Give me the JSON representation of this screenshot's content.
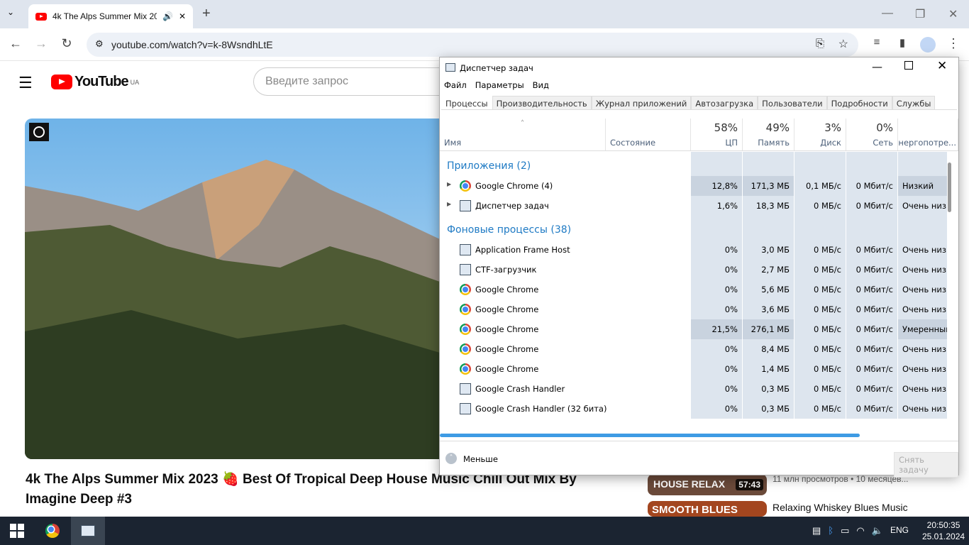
{
  "browser": {
    "tab_title": "4k The Alps Summer Mix 20",
    "url": "youtube.com/watch?v=k-8WsndhLtE"
  },
  "youtube": {
    "logo": "YouTube",
    "region": "UA",
    "search_placeholder": "Введите запрос",
    "video_title": "4k The Alps Summer Mix 2023 🍓 Best Of Tropical Deep House Music Chill Out Mix By Imagine Deep #3",
    "related": [
      {
        "thumb_text": "HOUSE RELAX",
        "duration": "57:43",
        "meta": "11 млн просмотров • 10 месяцев..."
      },
      {
        "thumb_text": "SMOOTH BLUES",
        "title": "Relaxing Whiskey Blues Music"
      }
    ]
  },
  "task_manager": {
    "title": "Диспетчер задач",
    "menu": [
      "Файл",
      "Параметры",
      "Вид"
    ],
    "tabs": [
      "Процессы",
      "Производительность",
      "Журнал приложений",
      "Автозагрузка",
      "Пользователи",
      "Подробности",
      "Службы"
    ],
    "columns": {
      "name": "Имя",
      "status": "Состояние",
      "cpu": {
        "pct": "58%",
        "label": "ЦП"
      },
      "memory": {
        "pct": "49%",
        "label": "Память"
      },
      "disk": {
        "pct": "3%",
        "label": "Диск"
      },
      "network": {
        "pct": "0%",
        "label": "Сеть"
      },
      "power": "Энергопотре..."
    },
    "groups": {
      "apps": "Приложения (2)",
      "background": "Фоновые процессы (38)"
    },
    "apps": [
      {
        "name": "Google Chrome (4)",
        "icon": "chrome",
        "cpu": "12,8%",
        "mem": "171,3 МБ",
        "disk": "0,1 МБ/с",
        "net": "0 Мбит/с",
        "power": "Низкий"
      },
      {
        "name": "Диспетчер задач",
        "icon": "taskmgr",
        "cpu": "1,6%",
        "mem": "18,3 МБ",
        "disk": "0 МБ/с",
        "net": "0 Мбит/с",
        "power": "Очень низк"
      }
    ],
    "background": [
      {
        "name": "Application Frame Host",
        "icon": "generic",
        "cpu": "0%",
        "mem": "3,0 МБ",
        "disk": "0 МБ/с",
        "net": "0 Мбит/с",
        "power": "Очень низк"
      },
      {
        "name": "CTF-загрузчик",
        "icon": "generic",
        "cpu": "0%",
        "mem": "2,7 МБ",
        "disk": "0 МБ/с",
        "net": "0 Мбит/с",
        "power": "Очень низк"
      },
      {
        "name": "Google Chrome",
        "icon": "chrome",
        "cpu": "0%",
        "mem": "5,6 МБ",
        "disk": "0 МБ/с",
        "net": "0 Мбит/с",
        "power": "Очень низк"
      },
      {
        "name": "Google Chrome",
        "icon": "chrome",
        "cpu": "0%",
        "mem": "3,6 МБ",
        "disk": "0 МБ/с",
        "net": "0 Мбит/с",
        "power": "Очень низк"
      },
      {
        "name": "Google Chrome",
        "icon": "chrome",
        "cpu": "21,5%",
        "mem": "276,1 МБ",
        "disk": "0 МБ/с",
        "net": "0 Мбит/с",
        "power": "Умеренный"
      },
      {
        "name": "Google Chrome",
        "icon": "chrome",
        "cpu": "0%",
        "mem": "8,4 МБ",
        "disk": "0 МБ/с",
        "net": "0 Мбит/с",
        "power": "Очень низк"
      },
      {
        "name": "Google Chrome",
        "icon": "chrome",
        "cpu": "0%",
        "mem": "1,4 МБ",
        "disk": "0 МБ/с",
        "net": "0 Мбит/с",
        "power": "Очень низк"
      },
      {
        "name": "Google Crash Handler",
        "icon": "generic",
        "cpu": "0%",
        "mem": "0,3 МБ",
        "disk": "0 МБ/с",
        "net": "0 Мбит/с",
        "power": "Очень низк"
      },
      {
        "name": "Google Crash Handler (32 бита)",
        "icon": "generic",
        "cpu": "0%",
        "mem": "0,3 МБ",
        "disk": "0 МБ/с",
        "net": "0 Мбит/с",
        "power": "Очень низк"
      }
    ],
    "fewer_label": "Меньше",
    "end_task_label": "Снять задачу"
  },
  "taskbar": {
    "lang": "ENG",
    "time": "20:50:35",
    "date": "25.01.2024"
  }
}
